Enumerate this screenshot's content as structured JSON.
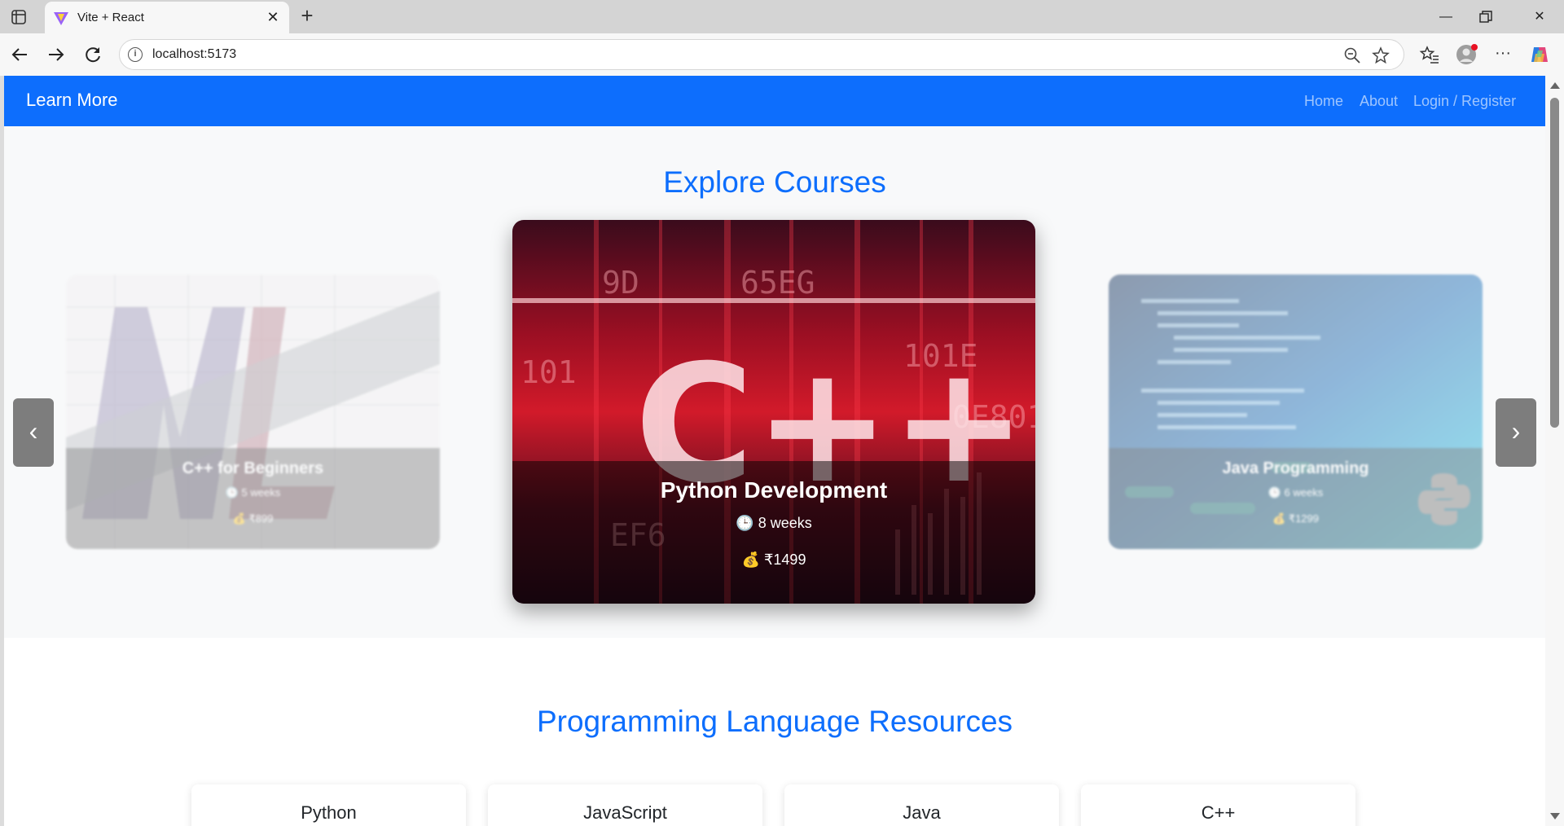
{
  "browser": {
    "tab_title": "Vite + React",
    "url": "localhost:5173"
  },
  "navbar": {
    "brand": "Learn More",
    "links": [
      "Home",
      "About",
      "Login / Register"
    ]
  },
  "hero": {
    "title": "Explore Courses",
    "cards": [
      {
        "title": "C++ for Beginners",
        "duration": "5 weeks",
        "price": "₹899",
        "image_icon": "ml-ruler-image"
      },
      {
        "title": "Python Development",
        "duration": "8 weeks",
        "price": "₹1499",
        "image_icon": "cpp-image",
        "image_text": "C++"
      },
      {
        "title": "Java Programming",
        "duration": "6 weeks",
        "price": "₹1299",
        "image_icon": "code-screen-image"
      }
    ],
    "prev_label": "‹",
    "next_label": "›"
  },
  "resources": {
    "title": "Programming Language Resources",
    "items": [
      "Python",
      "JavaScript",
      "Java",
      "C++"
    ]
  },
  "colors": {
    "primary": "#0d6efd",
    "hero_bg": "#f8f9fa"
  }
}
